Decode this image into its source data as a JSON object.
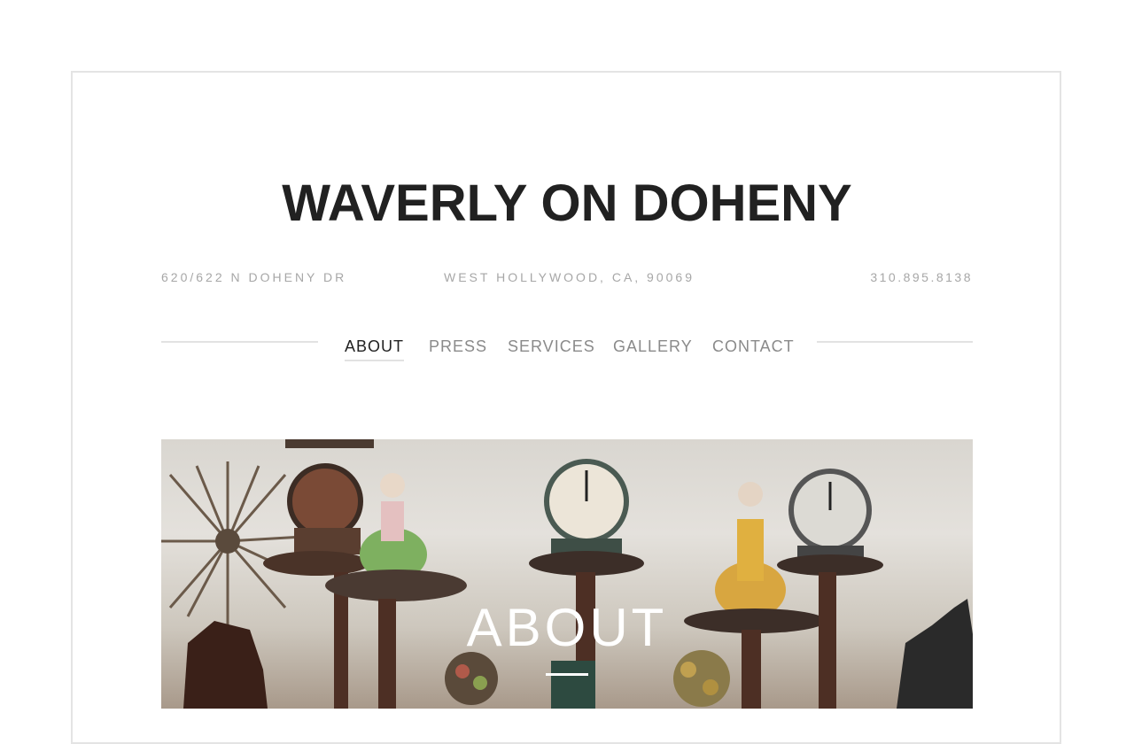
{
  "site": {
    "title": "WAVERLY ON DOHENY"
  },
  "info": {
    "address": "620/622 N DOHENY DR",
    "city": "WEST HOLLYWOOD, CA, 90069",
    "phone": "310.895.8138"
  },
  "nav": {
    "items": [
      {
        "label": "ABOUT",
        "active": true
      },
      {
        "label": "PRESS",
        "active": false
      },
      {
        "label": "SERVICES",
        "active": false
      },
      {
        "label": "GALLERY",
        "active": false
      },
      {
        "label": "CONTACT",
        "active": false
      }
    ]
  },
  "hero": {
    "title": "ABOUT"
  },
  "colors": {
    "title": "#212121",
    "info_text": "#a7a7a7",
    "nav_text": "#8a8a8a",
    "nav_active": "#222222",
    "rule": "#e2e2e2"
  }
}
